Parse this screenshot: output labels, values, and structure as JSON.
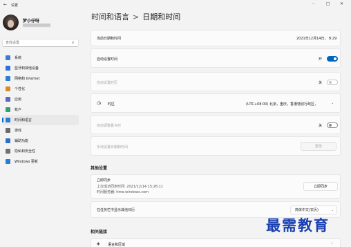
{
  "app": {
    "title": "设置"
  },
  "user": {
    "name": "梦小仔呀"
  },
  "search": {
    "placeholder": "查找设置"
  },
  "nav": [
    {
      "label": "系统",
      "color": "#3a7bd5"
    },
    {
      "label": "蓝牙和其他设备",
      "color": "#2f6fdb"
    },
    {
      "label": "网络和 Internet",
      "color": "#2a7fd4"
    },
    {
      "label": "个性化",
      "color": "#d98a2b"
    },
    {
      "label": "应用",
      "color": "#5b6abf"
    },
    {
      "label": "帐户",
      "color": "#2fa36b"
    },
    {
      "label": "时间和语言",
      "color": "#2b7bd4",
      "active": true
    },
    {
      "label": "游戏",
      "color": "#6c6c6c"
    },
    {
      "label": "辅助功能",
      "color": "#2b6fc9"
    },
    {
      "label": "隐私和安全性",
      "color": "#707070"
    },
    {
      "label": "Windows 更新",
      "color": "#2b7bd4"
    }
  ],
  "breadcrumb": {
    "parent": "时间和语言",
    "separator": ">",
    "current": "日期和时间"
  },
  "settings": {
    "current_label": "当前日期和时间",
    "current_value": "2021年12月14日，  8:29",
    "auto_time_label": "自动设置时间",
    "auto_time_state": "开",
    "auto_tz_label": "自动设置时区",
    "auto_tz_state": "关",
    "timezone_label": "时区",
    "timezone_value": "(UTC+08:00) 北京，重庆，香港特别行政区，",
    "dst_label": "自动调整夏令时",
    "dst_state": "关",
    "manual_label": "手动设置日期和时间",
    "manual_button": "更改"
  },
  "other": {
    "title": "其他设置",
    "sync_title": "立即同步",
    "sync_line1": "上次成功同步时间: 2021/12/14 15:26:11",
    "sync_line2": "时间服务器: time.windows.com",
    "sync_button": "立即同步",
    "calendar_label": "在任务栏中显示其他日历",
    "calendar_value": "简体中文(农历)"
  },
  "related": {
    "title": "相关链接",
    "item": "语言和区域"
  },
  "watermark": "最需教育"
}
